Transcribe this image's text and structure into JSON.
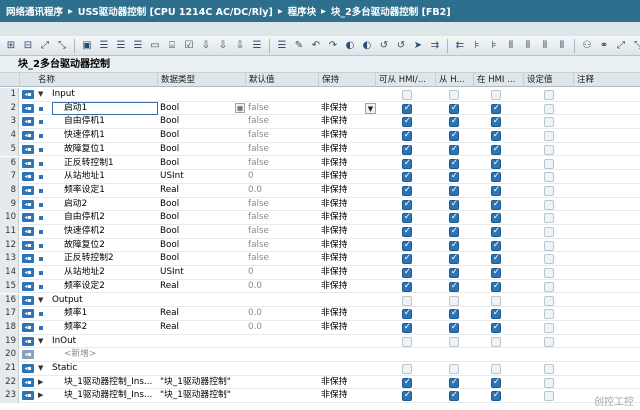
{
  "breadcrumb": [
    "网络通讯程序",
    "USS驱动器控制 [CPU 1214C AC/DC/Rly]",
    "程序块",
    "块_2多台驱动器控制 [FB2]"
  ],
  "block_name": "块_2多台驱动器控制",
  "toolbar_icons": [
    "insert-row-icon",
    "delete-row-icon",
    "expand-icon",
    "collapse-icon",
    "monitor-icon",
    "list-icon",
    "list-icon",
    "list-icon",
    "comment-icon",
    "network-icon",
    "checkbox-icon",
    "download-icon",
    "download-icon",
    "download-icon",
    "list-icon",
    "list-icon",
    "edit-icon",
    "undo-icon",
    "redo-icon",
    "call-icon",
    "call-icon",
    "jump-icon",
    "jump-icon",
    "go-icon",
    "forward-icon",
    "back-icon",
    "filter-icon",
    "filter-icon",
    "column-icon",
    "column-icon",
    "column-icon",
    "column-icon",
    "user-icon",
    "eyeglass-icon",
    "expand-icon",
    "collapse-icon"
  ],
  "columns": {
    "name": "名称",
    "type": "数据类型",
    "default": "默认值",
    "retain": "保持",
    "from_hmi": "可从 HMI/...",
    "hmi_visible": "从 H...",
    "hmi_writable": "在 HMI ...",
    "setpoint": "设定值",
    "comment": "注释"
  },
  "rows": [
    {
      "num": "1",
      "kind": "section",
      "name": "Input",
      "type": "",
      "default": "",
      "retain": "",
      "c1": "off",
      "c2": "off",
      "c3": "off",
      "c4": "off"
    },
    {
      "num": "2",
      "kind": "item",
      "name": "启动1",
      "type": "Bool",
      "default": "false",
      "retain": "非保持",
      "c1": "on",
      "c2": "on",
      "c3": "on",
      "c4": "off",
      "selected": true
    },
    {
      "num": "3",
      "kind": "item",
      "name": "自由停机1",
      "type": "Bool",
      "default": "false",
      "retain": "非保持",
      "c1": "on",
      "c2": "on",
      "c3": "on",
      "c4": "off"
    },
    {
      "num": "4",
      "kind": "item",
      "name": "快速停机1",
      "type": "Bool",
      "default": "false",
      "retain": "非保持",
      "c1": "on",
      "c2": "on",
      "c3": "on",
      "c4": "off"
    },
    {
      "num": "5",
      "kind": "item",
      "name": "故障复位1",
      "type": "Bool",
      "default": "false",
      "retain": "非保持",
      "c1": "on",
      "c2": "on",
      "c3": "on",
      "c4": "off"
    },
    {
      "num": "6",
      "kind": "item",
      "name": "正反转控制1",
      "type": "Bool",
      "default": "false",
      "retain": "非保持",
      "c1": "on",
      "c2": "on",
      "c3": "on",
      "c4": "off"
    },
    {
      "num": "7",
      "kind": "item",
      "name": "从站地址1",
      "type": "USInt",
      "default": "0",
      "retain": "非保持",
      "c1": "on",
      "c2": "on",
      "c3": "on",
      "c4": "off"
    },
    {
      "num": "8",
      "kind": "item",
      "name": "频率设定1",
      "type": "Real",
      "default": "0.0",
      "retain": "非保持",
      "c1": "on",
      "c2": "on",
      "c3": "on",
      "c4": "off"
    },
    {
      "num": "9",
      "kind": "item",
      "name": "启动2",
      "type": "Bool",
      "default": "false",
      "retain": "非保持",
      "c1": "on",
      "c2": "on",
      "c3": "on",
      "c4": "off"
    },
    {
      "num": "10",
      "kind": "item",
      "name": "自由停机2",
      "type": "Bool",
      "default": "false",
      "retain": "非保持",
      "c1": "on",
      "c2": "on",
      "c3": "on",
      "c4": "off"
    },
    {
      "num": "11",
      "kind": "item",
      "name": "快速停机2",
      "type": "Bool",
      "default": "false",
      "retain": "非保持",
      "c1": "on",
      "c2": "on",
      "c3": "on",
      "c4": "off"
    },
    {
      "num": "12",
      "kind": "item",
      "name": "故障复位2",
      "type": "Bool",
      "default": "false",
      "retain": "非保持",
      "c1": "on",
      "c2": "on",
      "c3": "on",
      "c4": "off"
    },
    {
      "num": "13",
      "kind": "item",
      "name": "正反转控制2",
      "type": "Bool",
      "default": "false",
      "retain": "非保持",
      "c1": "on",
      "c2": "on",
      "c3": "on",
      "c4": "off"
    },
    {
      "num": "14",
      "kind": "item",
      "name": "从站地址2",
      "type": "USInt",
      "default": "0",
      "retain": "非保持",
      "c1": "on",
      "c2": "on",
      "c3": "on",
      "c4": "off"
    },
    {
      "num": "15",
      "kind": "item",
      "name": "频率设定2",
      "type": "Real",
      "default": "0.0",
      "retain": "非保持",
      "c1": "on",
      "c2": "on",
      "c3": "on",
      "c4": "off"
    },
    {
      "num": "16",
      "kind": "section",
      "name": "Output",
      "type": "",
      "default": "",
      "retain": "",
      "c1": "off",
      "c2": "off",
      "c3": "off",
      "c4": "off"
    },
    {
      "num": "17",
      "kind": "item",
      "name": "频率1",
      "type": "Real",
      "default": "0.0",
      "retain": "非保持",
      "c1": "on",
      "c2": "on",
      "c3": "on",
      "c4": "off"
    },
    {
      "num": "18",
      "kind": "item",
      "name": "频率2",
      "type": "Real",
      "default": "0.0",
      "retain": "非保持",
      "c1": "on",
      "c2": "on",
      "c3": "on",
      "c4": "off"
    },
    {
      "num": "19",
      "kind": "section",
      "name": "InOut",
      "type": "",
      "default": "",
      "retain": "",
      "c1": "off",
      "c2": "off",
      "c3": "off",
      "c4": "off"
    },
    {
      "num": "20",
      "kind": "new",
      "name": "<新增>",
      "type": "",
      "default": "",
      "retain": "",
      "c1": "none",
      "c2": "none",
      "c3": "none",
      "c4": "none"
    },
    {
      "num": "21",
      "kind": "section",
      "name": "Static",
      "type": "",
      "default": "",
      "retain": "",
      "c1": "off",
      "c2": "off",
      "c3": "off",
      "c4": "off"
    },
    {
      "num": "22",
      "kind": "instance",
      "name": "块_1驱动器控制_Ins...",
      "type": "\"块_1驱动器控制\"",
      "default": "",
      "retain": "非保持",
      "c1": "on",
      "c2": "on",
      "c3": "on",
      "c4": "off"
    },
    {
      "num": "23",
      "kind": "instance",
      "name": "块_1驱动器控制_Ins...",
      "type": "\"块_1驱动器控制\"",
      "default": "",
      "retain": "非保持",
      "c1": "on",
      "c2": "on",
      "c3": "on",
      "c4": "off"
    }
  ],
  "watermark": "创控工控"
}
